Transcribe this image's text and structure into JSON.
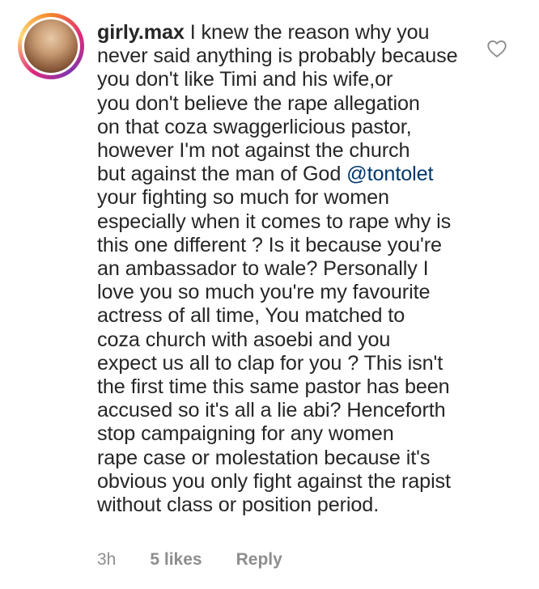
{
  "comment": {
    "username": "girly.max",
    "mention": "@tontolet",
    "lines": [
      " I knew the reason why you",
      "never said anything is probably because",
      "you don't like Timi and his wife,or",
      "you don't believe the rape allegation",
      "on that coza swaggerlicious pastor,",
      "however I'm not against the church",
      "but against the man of God ",
      "your fighting so much for women",
      "especially when it comes to rape why is",
      "this one different ? Is it because you're",
      "an ambassador to wale? Personally I",
      "love you so much you're my favourite",
      "actress of all time, You matched to",
      "coza church with asoebi and you",
      "expect us all to clap for you ? This isn't",
      "the first time this same pastor has been",
      "accused so it's all a lie abi? Henceforth",
      "stop campaigning for any women",
      "rape case or molestation because it's",
      "obvious you only fight against the rapist",
      "without class or position period."
    ],
    "time": "3h",
    "likes": "5 likes",
    "reply": "Reply"
  },
  "icons": {
    "like": "heart-outline-icon",
    "avatar": "user-avatar"
  },
  "colors": {
    "text": "#262626",
    "mention": "#00376b",
    "meta": "#8e8e8e",
    "heart_stroke": "#8e8e8e"
  }
}
